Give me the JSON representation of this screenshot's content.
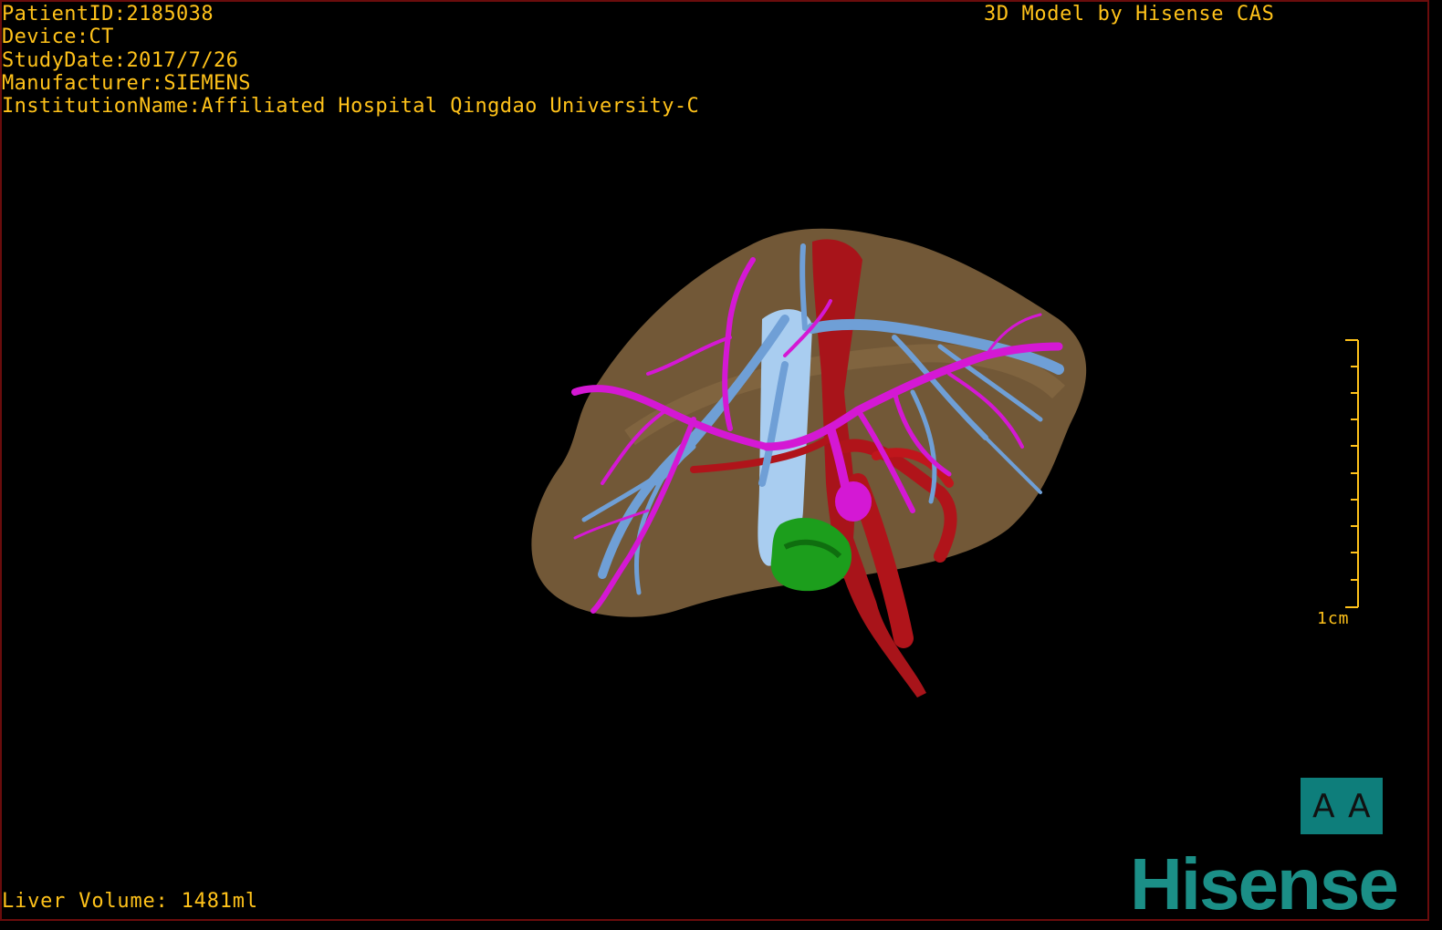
{
  "header": {
    "patient_id": "PatientID:2185038",
    "device": "Device:CT",
    "study_date": "StudyDate:2017/7/26",
    "manufacturer": "Manufacturer:SIEMENS",
    "institution": "InstitutionName:Affiliated Hospital Qingdao University-C"
  },
  "brand_text": "3D Model by Hisense CAS",
  "footer": {
    "liver_volume": "Liver Volume: 1481ml"
  },
  "scale": {
    "label": "1cm",
    "color": "#ffc21a"
  },
  "orientation": {
    "left_glyph": "A",
    "right_glyph": "A"
  },
  "logo": {
    "text": "Hisense",
    "color": "#1b8f87"
  },
  "model_colors": {
    "liver": "#8a6b45",
    "portal_vein": "#d418d4",
    "hepatic_vein": "#6f9fd6",
    "ivc": "#a9cdf0",
    "artery": "#b0141a",
    "gallbladder": "#1c9e1c"
  }
}
